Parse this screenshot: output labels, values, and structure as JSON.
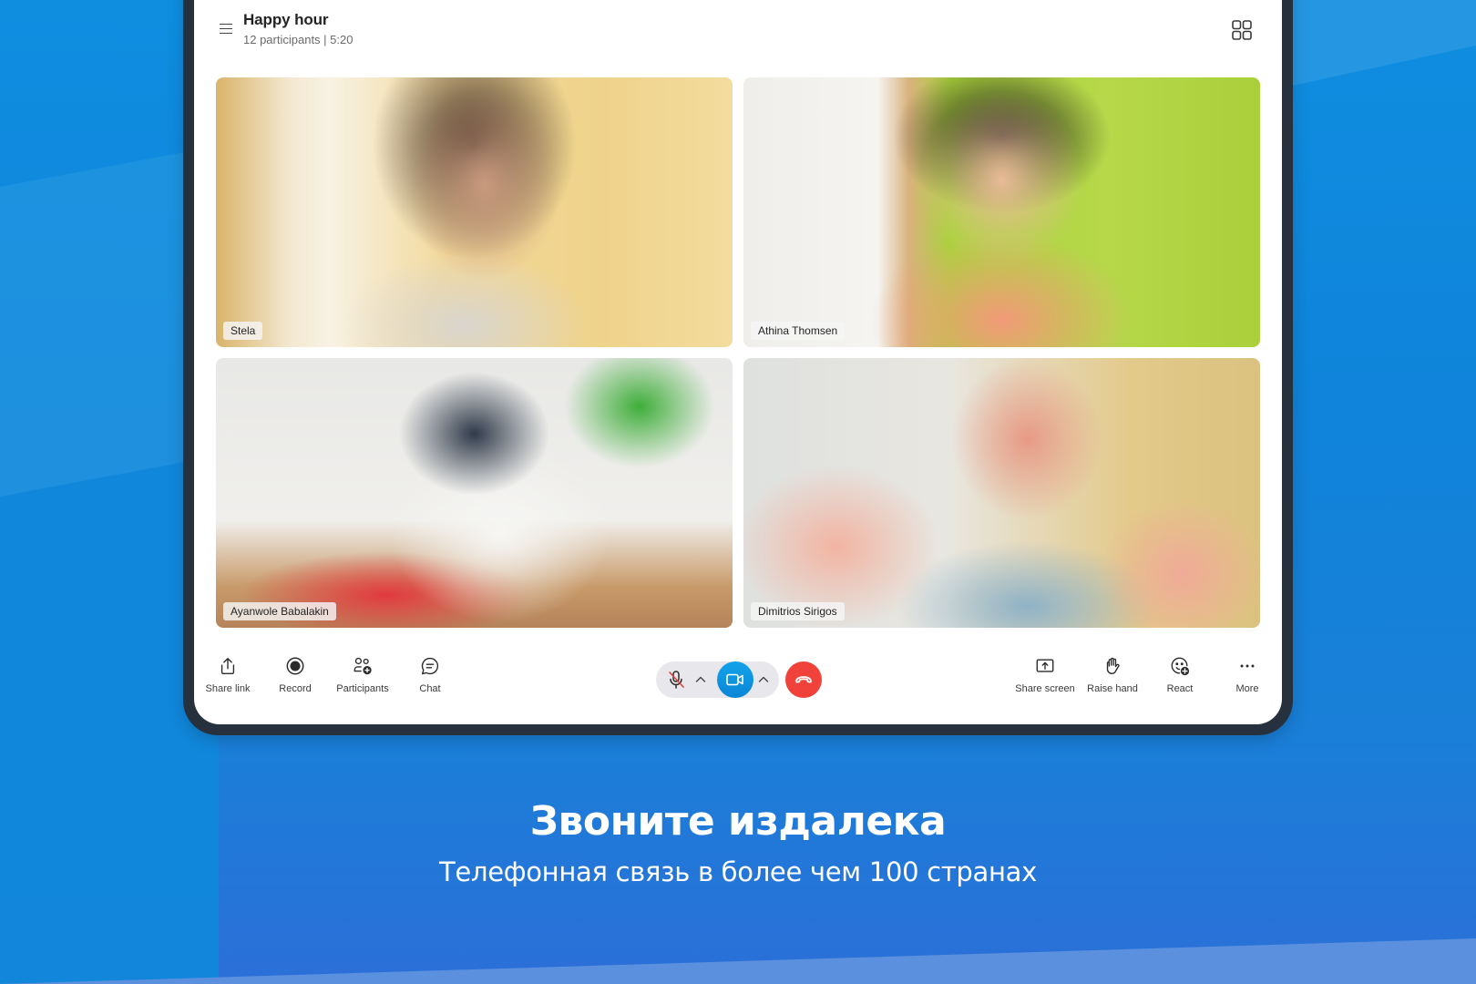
{
  "call": {
    "title": "Happy hour",
    "subtitle": "12 participants | 5:20"
  },
  "participants": [
    {
      "name": "Stela"
    },
    {
      "name": "Athina Thomsen"
    },
    {
      "name": "Ayanwole Babalakin"
    },
    {
      "name": "Dimitrios Sirigos"
    }
  ],
  "toolbar": {
    "left": [
      {
        "label": "Share link",
        "icon": "share-icon"
      },
      {
        "label": "Record",
        "icon": "record-icon"
      },
      {
        "label": "Participants",
        "icon": "participants-add-icon"
      },
      {
        "label": "Chat",
        "icon": "chat-icon"
      }
    ],
    "right": [
      {
        "label": "Share screen",
        "icon": "share-screen-icon"
      },
      {
        "label": "Raise hand",
        "icon": "raise-hand-icon"
      },
      {
        "label": "React",
        "icon": "react-emoji-icon"
      },
      {
        "label": "More",
        "icon": "more-icon"
      }
    ],
    "controls": {
      "mic_state": "muted",
      "camera_state": "on",
      "hangup": "end-call"
    }
  },
  "colors": {
    "camera_button": "#0a8fe0",
    "hangup_button": "#f0413a",
    "mic_mute_slash": "#e0403a",
    "background": "#0f88dc"
  },
  "promo": {
    "headline": "Звоните издалека",
    "subheadline": "Телефонная связь в более чем 100 странах"
  }
}
